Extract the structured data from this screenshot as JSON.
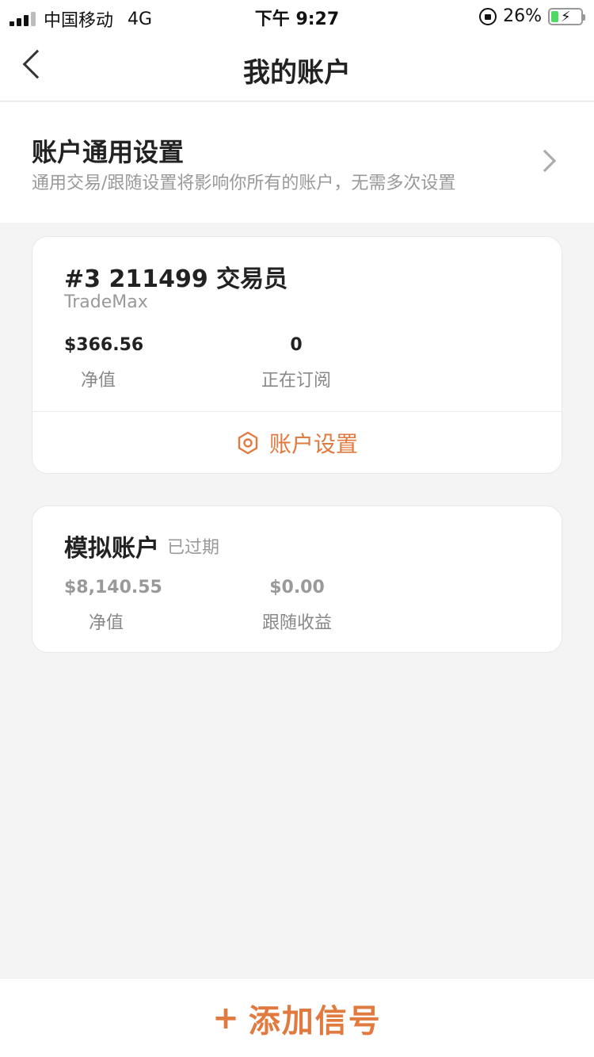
{
  "status_bar": {
    "carrier": "中国移动",
    "network": "4G",
    "time": "下午 9:27",
    "battery": "26%",
    "battery_level": 0.26,
    "icons": [
      "signal-icon",
      "rotation-lock-icon",
      "battery-charging-icon"
    ]
  },
  "nav": {
    "title": "我的账户",
    "back_icon": "chevron-left-icon"
  },
  "general_settings": {
    "title": "账户通用设置",
    "description": "通用交易/跟随设置将影响你所有的账户，无需多次设置",
    "icon": "chevron-right-icon"
  },
  "accounts": [
    {
      "title": "#3 211499 交易员",
      "subtitle": "TradeMax",
      "stats": [
        {
          "value": "$366.56",
          "label": "净值"
        },
        {
          "value": "0",
          "label": "正在订阅"
        }
      ],
      "settings_button": "账户设置",
      "settings_icon": "hexagon-gear-icon"
    },
    {
      "title": "模拟账户",
      "badge": "已过期",
      "stats": [
        {
          "value": "$8,140.55",
          "label": "净值"
        },
        {
          "value": "$0.00",
          "label": "跟随收益"
        }
      ]
    }
  ],
  "bottom": {
    "plus": "+",
    "label": "添加信号"
  },
  "colors": {
    "accent": "#e07a3f",
    "background": "#f4f4f4",
    "card": "#ffffff",
    "muted_text": "#999999"
  }
}
